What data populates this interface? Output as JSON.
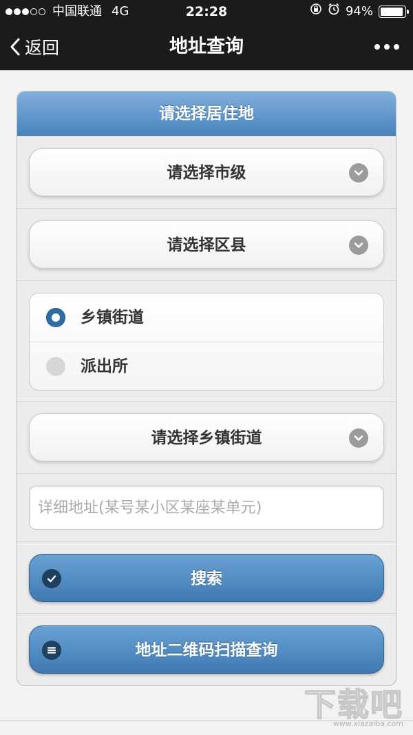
{
  "status_bar": {
    "carrier": "中国联通",
    "network": "4G",
    "time": "22:28",
    "battery_text": "94%",
    "battery_level": 0.94
  },
  "nav": {
    "back_label": "返回",
    "title": "地址查询"
  },
  "form": {
    "header": "请选择居住地",
    "city_select": "请选择市级",
    "district_select": "请选择区县",
    "radio_options": [
      "乡镇街道",
      "派出所"
    ],
    "radio_selected": "乡镇街道",
    "town_select": "请选择乡镇街道",
    "address_placeholder": "详细地址(某号某小区某座某单元)",
    "address_value": "",
    "search_button": "搜索",
    "qr_button": "地址二维码扫描查询"
  },
  "watermark": {
    "logo": "下载吧",
    "url": "www.xiazaiba.com"
  },
  "colors": {
    "nav_background": "#1b1b1b",
    "accent_blue": "#4a84bd",
    "chevron_gray": "#9b9b9b"
  }
}
